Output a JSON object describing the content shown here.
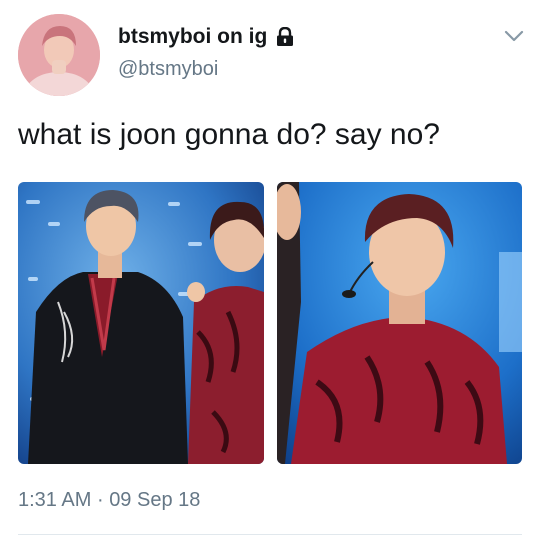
{
  "user": {
    "display_name": "btsmyboi on ig",
    "handle": "@btsmyboi",
    "protected_icon": "lock-icon"
  },
  "menu_icon": "chevron-down-icon",
  "tweet": {
    "text": "what is joon gonna do? say no?"
  },
  "media": [
    {
      "alt": "photo-left"
    },
    {
      "alt": "photo-right"
    }
  ],
  "meta": {
    "time": "1:31 AM",
    "separator": "·",
    "date": "09 Sep 18"
  },
  "colors": {
    "text": "#14171a",
    "secondary": "#657786",
    "divider": "#e1e8ed"
  }
}
